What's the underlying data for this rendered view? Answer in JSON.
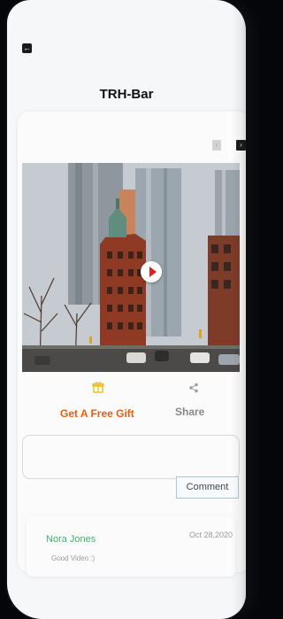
{
  "header": {
    "title": "TRH-Bar"
  },
  "navigation": {
    "back_icon": "back-arrow-icon",
    "prev_icon": "chevron-left-icon",
    "next_icon": "chevron-right-icon"
  },
  "media": {
    "play_icon": "play-icon"
  },
  "actions": {
    "gift": {
      "label": "Get A Free Gift",
      "icon": "gift-icon",
      "color": "#f05a0e"
    },
    "share": {
      "label": "Share",
      "icon": "share-icon",
      "color": "#8a8a8a"
    }
  },
  "comment_form": {
    "input_value": "",
    "button_label": "Comment"
  },
  "comments": [
    {
      "name": "Nora Jones",
      "date": "Oct 28,2020",
      "text": "Good Video :)"
    }
  ]
}
